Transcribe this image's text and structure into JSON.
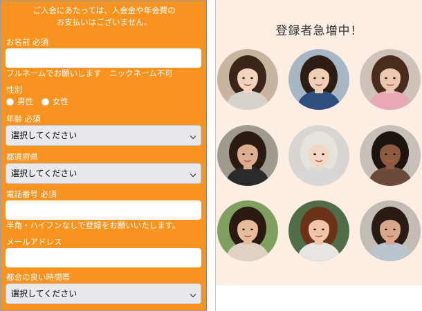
{
  "form": {
    "notice_line1": "ご入会にあたっては、入会金や年会費の",
    "notice_line2": "お支払いはございません。",
    "name_label": "お名前 必須",
    "name_value": "",
    "name_note": "フルネームでお願いします　ニックネーム不可",
    "gender_label": "性別",
    "gender_options": [
      "男性",
      "女性"
    ],
    "age_label": "年齢 必須",
    "age_select": "選択してください",
    "pref_label": "都道府県",
    "pref_select": "選択してください",
    "phone_label": "電話番号 必須",
    "phone_value": "",
    "phone_note": "半角・ハイフンなしで登録をお願いいたします。",
    "email_label": "メールアドレス",
    "email_value": "",
    "time_label": "都合の良い時間帯",
    "time_select": "選択してください"
  },
  "gallery": {
    "title": "登録者急増中！",
    "profiles": [
      {
        "hair": "#3b2418",
        "bg": "#c9b4a0",
        "skin": "#f1d3bf",
        "top": "#d8d2cc"
      },
      {
        "hair": "#2e1d14",
        "bg": "#a8b7c4",
        "skin": "#f0cfb6",
        "top": "#2f4f7f"
      },
      {
        "hair": "#4a2c1c",
        "bg": "#cfc2ba",
        "skin": "#edc8b0",
        "top": "#e8a8b5"
      },
      {
        "hair": "#2a1a12",
        "bg": "#9e9a8f",
        "skin": "#dcae8f",
        "top": "#2a2a2a"
      },
      {
        "hair": "#e6e2dc",
        "bg": "#d9d6d2",
        "skin": "#f3d7c5",
        "top": "#d8d8d8"
      },
      {
        "hair": "#1d1410",
        "bg": "#c7c0b8",
        "skin": "#8d5a3f",
        "top": "#6b4a3a"
      },
      {
        "hair": "#2b1a12",
        "bg": "#7fa05f",
        "skin": "#e6bc9c",
        "top": "#e0d2c2"
      },
      {
        "hair": "#6b3218",
        "bg": "#4f6e48",
        "skin": "#f0c4a8",
        "top": "#e8e4e0"
      },
      {
        "hair": "#2a1c14",
        "bg": "#c2bcb4",
        "skin": "#d9a88a",
        "top": "#b9c4cc"
      }
    ]
  }
}
